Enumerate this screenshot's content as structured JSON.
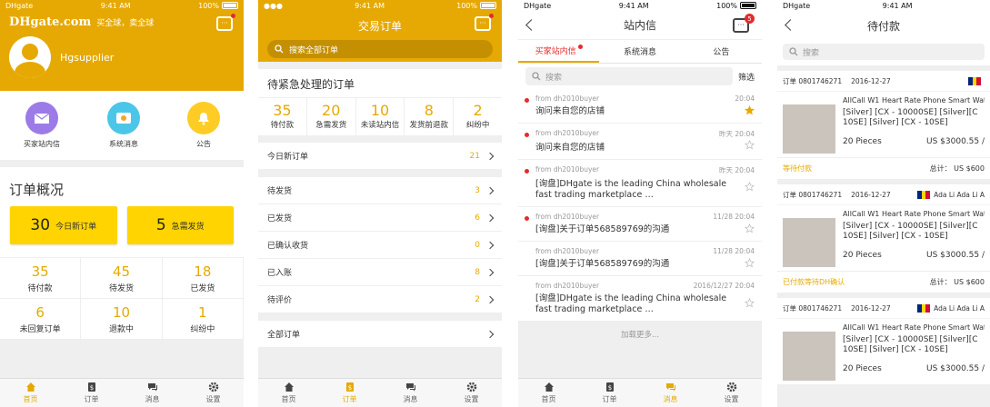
{
  "status": {
    "carrier": "DHgate",
    "time": "9:41 AM",
    "battery": "100%"
  },
  "tabbar": [
    {
      "label": "首页",
      "icon": "home-icon"
    },
    {
      "label": "订单",
      "icon": "order-icon"
    },
    {
      "label": "消息",
      "icon": "message-icon"
    },
    {
      "label": "设置",
      "icon": "gear-icon"
    }
  ],
  "s1": {
    "logo": "DHgate.com",
    "slogan": "买全球，卖全球",
    "username": "Hgsupplier",
    "quick": [
      {
        "label": "买家站内信",
        "icon": "mail-icon",
        "color": "#9c7be8"
      },
      {
        "label": "系统消息",
        "icon": "system-icon",
        "color": "#4cc6e8"
      },
      {
        "label": "公告",
        "icon": "bell-icon",
        "color": "#ffcc26"
      }
    ],
    "overview_title": "订单概况",
    "big": [
      {
        "num": "30",
        "label": "今日新订单"
      },
      {
        "num": "5",
        "label": "急需发货"
      }
    ],
    "stats": [
      {
        "num": "35",
        "label": "待付款"
      },
      {
        "num": "45",
        "label": "待发货"
      },
      {
        "num": "18",
        "label": "已发货"
      },
      {
        "num": "6",
        "label": "未回复订单"
      },
      {
        "num": "10",
        "label": "退款中"
      },
      {
        "num": "1",
        "label": "纠纷中"
      }
    ]
  },
  "s2": {
    "title": "交易订单",
    "search": "搜索全部订单",
    "urgent_title": "待紧急处理的订单",
    "counts": [
      {
        "num": "35",
        "label": "待付款"
      },
      {
        "num": "20",
        "label": "急需发货"
      },
      {
        "num": "10",
        "label": "未读站内信"
      },
      {
        "num": "8",
        "label": "发货前退款"
      },
      {
        "num": "2",
        "label": "纠纷中"
      }
    ],
    "today": {
      "label": "今日新订单",
      "num": "21"
    },
    "rows": [
      {
        "label": "待发货",
        "num": "3"
      },
      {
        "label": "已发货",
        "num": "6"
      },
      {
        "label": "已确认收货",
        "num": "0"
      },
      {
        "label": "已入账",
        "num": "8"
      },
      {
        "label": "待评价",
        "num": "2"
      }
    ],
    "all": "全部订单"
  },
  "s3": {
    "title": "站内信",
    "badge": "5",
    "tabs": [
      "买家站内信",
      "系统消息",
      "公告"
    ],
    "search": "搜索",
    "filter": "筛选",
    "messages": [
      {
        "from": "from dh2010buyer",
        "time": "20:04",
        "text": "询问来自您的店铺",
        "unread": true,
        "starred": true
      },
      {
        "from": "from dh2010buyer",
        "time": "昨天 20:04",
        "text": "询问来自您的店铺",
        "unread": true,
        "starred": false
      },
      {
        "from": "from dh2010buyer",
        "time": "昨天 20:04",
        "text": "[询盘]DHgate is the leading China wholesale fast trading marketplace …",
        "unread": true,
        "starred": false
      },
      {
        "from": "from dh2010buyer",
        "time": "11/28 20:04",
        "text": "[询盘]关于订单568589769的沟通",
        "unread": true,
        "starred": false
      },
      {
        "from": "from dh2010buyer",
        "time": "11/28 20:04",
        "text": "[询盘]关于订单568589769的沟通",
        "unread": false,
        "starred": false
      },
      {
        "from": "from dh2010buyer",
        "time": "2016/12/27 20:04",
        "text": "[询盘]DHgate is the leading China wholesale fast trading marketplace …",
        "unread": false,
        "starred": false
      }
    ],
    "more": "加载更多..."
  },
  "s4": {
    "title": "待付款",
    "search": "搜索",
    "orders": [
      {
        "no": "订单 0801746271",
        "date": "2016-12-27",
        "buyer": "",
        "product": "AllCall W1 Heart Rate Phone Smart Wat",
        "spec": "[Silver] [CX - 10000SE] [Silver][C",
        "spec2": "10SE] [Silver] [CX - 10SE]",
        "qty": "20 Pieces",
        "price": "US $3000.55 /",
        "status": "等待付款",
        "total": "总计： US $600"
      },
      {
        "no": "订单 0801746271",
        "date": "2016-12-27",
        "buyer": "Ada Li Ada Li A",
        "product": "AllCall W1 Heart Rate Phone Smart Wat",
        "spec": "[Silver] [CX - 10000SE] [Silver][C",
        "spec2": "10SE] [Silver] [CX - 10SE]",
        "qty": "20 Pieces",
        "price": "US $3000.55 /",
        "status": "已付款等待DH确认",
        "total": "总计： US $600"
      },
      {
        "no": "订单 0801746271",
        "date": "2016-12-27",
        "buyer": "Ada Li Ada Li A",
        "product": "AllCall W1 Heart Rate Phone Smart Wat",
        "spec": "[Silver] [CX - 10000SE] [Silver][C",
        "spec2": "10SE] [Silver] [CX - 10SE]",
        "qty": "20 Pieces",
        "price": "US $3000.55 /",
        "status": "",
        "total": ""
      }
    ]
  },
  "colors": {
    "accent": "#e6a903",
    "red": "#e62a2a",
    "yellow_btn": "#ffd400"
  }
}
